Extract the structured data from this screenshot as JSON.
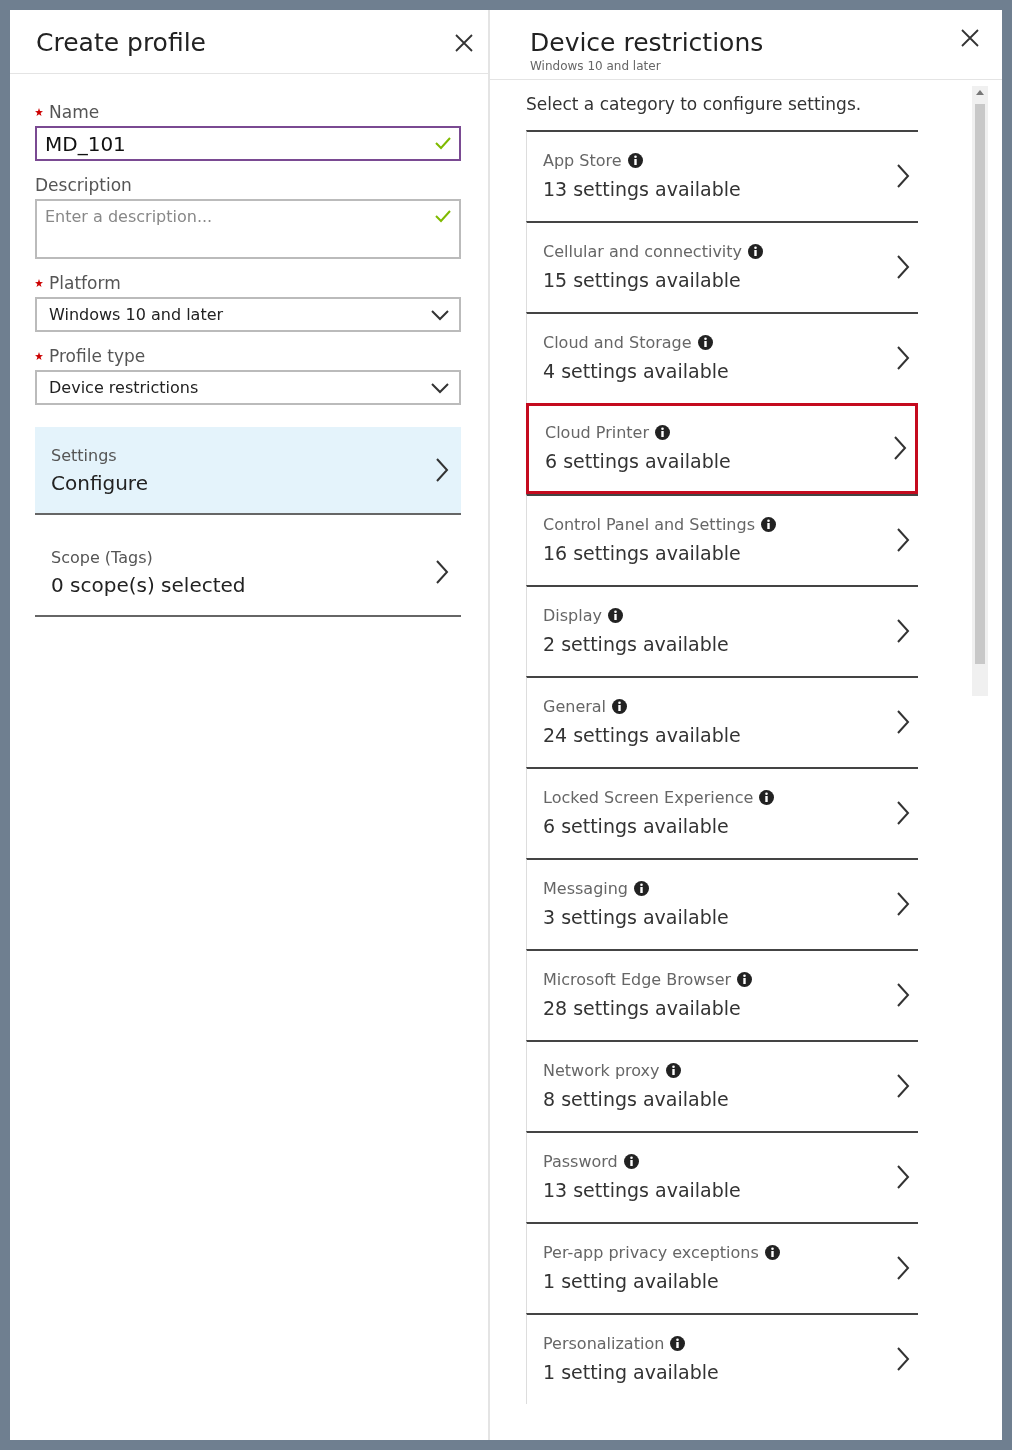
{
  "create_profile": {
    "title": "Create profile",
    "fields": [
      {
        "kind": "text",
        "label": "Name",
        "required": true,
        "value": "MD_101",
        "valid": true,
        "focused": true
      },
      {
        "kind": "textarea",
        "label": "Description",
        "required": false,
        "placeholder": "Enter a description...",
        "valid": true,
        "focused": false
      },
      {
        "kind": "select",
        "label": "Platform",
        "required": true,
        "value": "Windows 10 and later"
      },
      {
        "kind": "select",
        "label": "Profile type",
        "required": true,
        "value": "Device restrictions"
      }
    ],
    "nav_items": [
      {
        "label": "Settings",
        "value": "Configure",
        "selected": true
      },
      {
        "label": "Scope (Tags)",
        "value": "0 scope(s) selected",
        "selected": false
      }
    ]
  },
  "device_restrictions": {
    "title": "Device restrictions",
    "subtitle": "Windows 10 and later",
    "prompt": "Select a category to configure settings.",
    "categories": [
      {
        "name": "App Store",
        "count": "13 settings available",
        "highlighted": false
      },
      {
        "name": "Cellular and connectivity",
        "count": "15 settings available",
        "highlighted": false
      },
      {
        "name": "Cloud and Storage",
        "count": "4 settings available",
        "highlighted": false
      },
      {
        "name": "Cloud Printer",
        "count": "6 settings available",
        "highlighted": true
      },
      {
        "name": "Control Panel and Settings",
        "count": "16 settings available",
        "highlighted": false
      },
      {
        "name": "Display",
        "count": "2 settings available",
        "highlighted": false
      },
      {
        "name": "General",
        "count": "24 settings available",
        "highlighted": false
      },
      {
        "name": "Locked Screen Experience",
        "count": "6 settings available",
        "highlighted": false
      },
      {
        "name": "Messaging",
        "count": "3 settings available",
        "highlighted": false
      },
      {
        "name": "Microsoft Edge Browser",
        "count": "28 settings available",
        "highlighted": false
      },
      {
        "name": "Network proxy",
        "count": "8 settings available",
        "highlighted": false
      },
      {
        "name": "Password",
        "count": "13 settings available",
        "highlighted": false
      },
      {
        "name": "Per-app privacy exceptions",
        "count": "1 setting available",
        "highlighted": false
      },
      {
        "name": "Personalization",
        "count": "1 setting available",
        "highlighted": false
      }
    ]
  }
}
